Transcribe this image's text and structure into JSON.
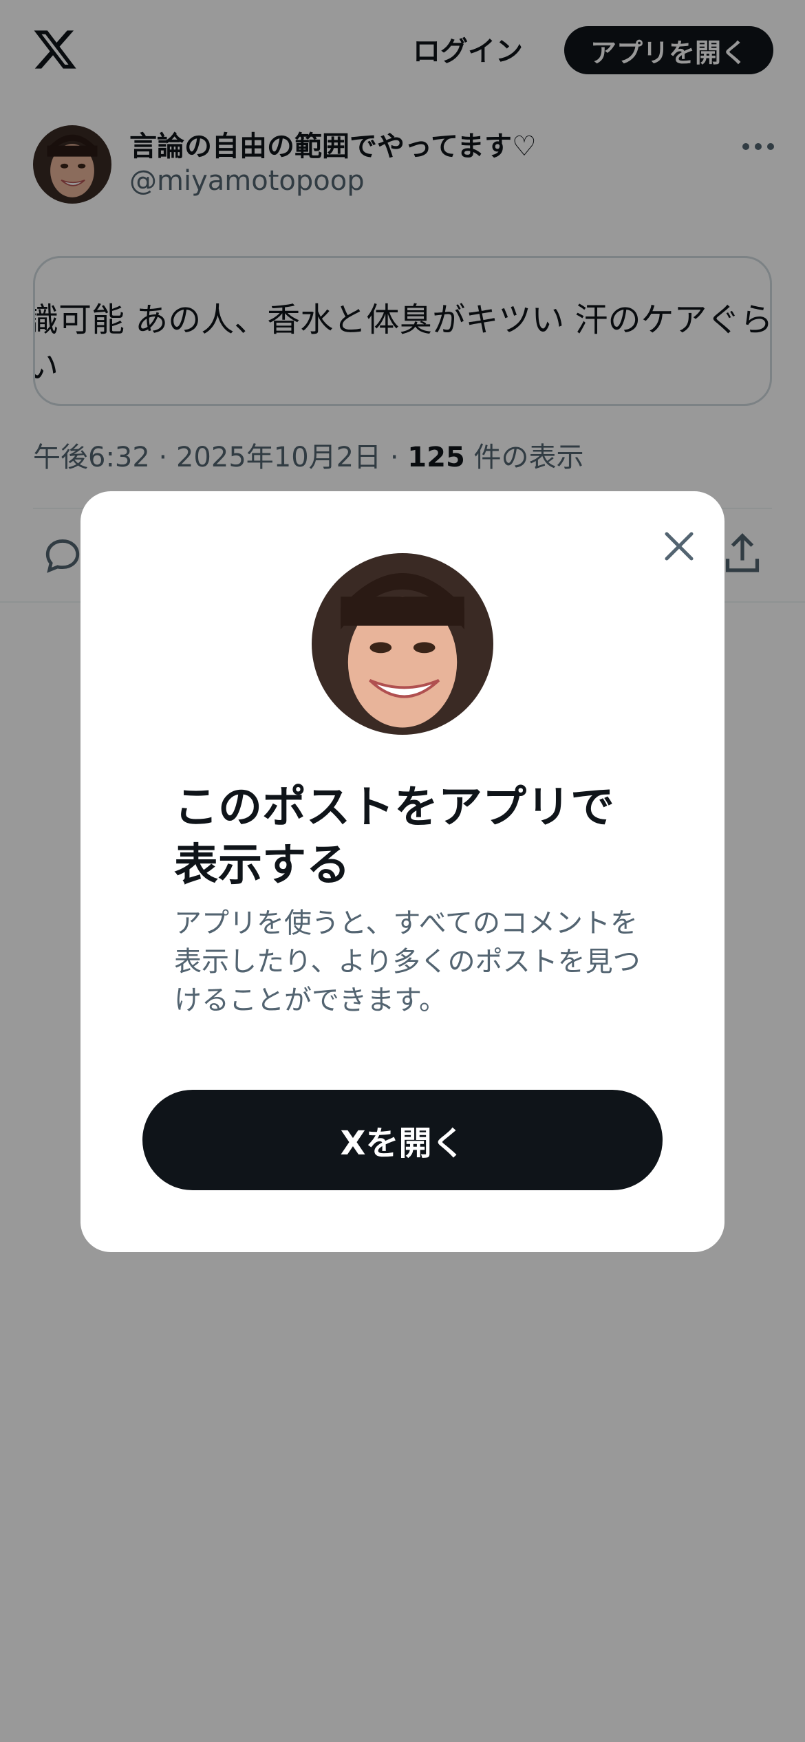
{
  "header": {
    "logo_icon": "x-logo-icon",
    "login_label": "ログイン",
    "open_app_label": "アプリを開く"
  },
  "post": {
    "author": {
      "display_name": "言論の自由の範囲でやってます♡",
      "handle": "@miyamotopoop"
    },
    "quoted_text_line1": "識可能 あの人、香水と体臭がキツい 汗のケアぐらいしてほ",
    "quoted_text_line2": "い",
    "meta": {
      "time": "午後6:32",
      "separator": "·",
      "date": "2025年10月2日",
      "view_count": "125",
      "view_label": "件の表示"
    }
  },
  "modal": {
    "title": "このポストをアプリで表示する",
    "description": "アプリを使うと、すべてのコメントを表示したり、より多くのポストを見つけることができます。",
    "button_label": "Xを開く"
  },
  "colors": {
    "text_primary": "#0f1419",
    "text_secondary": "#536471",
    "button_dark": "#0f1419",
    "overlay": "rgba(0,0,0,0.40)"
  }
}
